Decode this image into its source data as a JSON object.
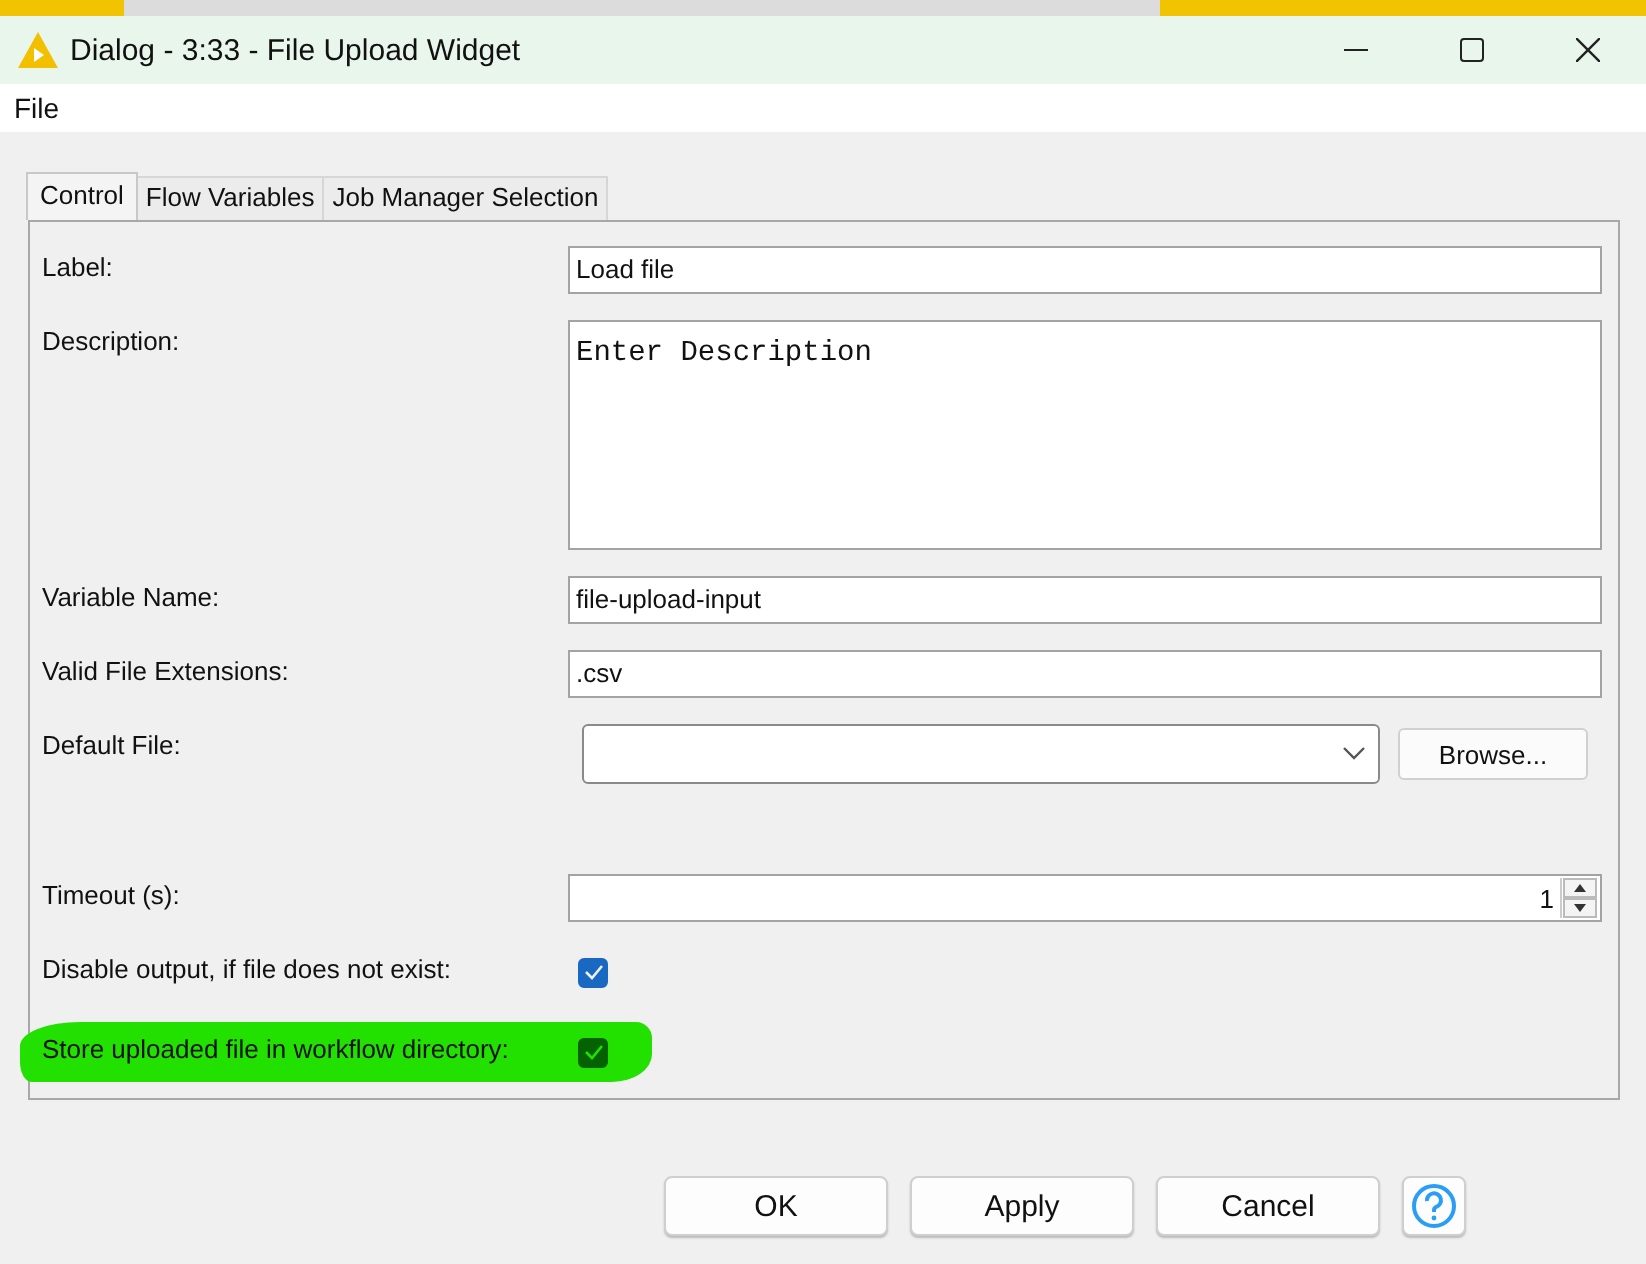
{
  "window": {
    "title": "Dialog - 3:33 - File Upload Widget"
  },
  "menu": [
    "File"
  ],
  "tabs": [
    {
      "label": "Control",
      "selected": true
    },
    {
      "label": "Flow Variables",
      "selected": false
    },
    {
      "label": "Job Manager Selection",
      "selected": false
    }
  ],
  "fields": [
    {
      "kind": "text",
      "label": "Label:",
      "value": "Load file"
    },
    {
      "kind": "textarea",
      "label": "Description:",
      "value": "Enter Description"
    },
    {
      "kind": "text",
      "label": "Variable Name:",
      "value": "file-upload-input"
    },
    {
      "kind": "text",
      "label": "Valid File Extensions:",
      "value": ".csv"
    },
    {
      "kind": "file",
      "label": "Default File:",
      "button": "Browse..."
    },
    {
      "kind": "spinner",
      "label": "Timeout (s):",
      "value": "1"
    },
    {
      "kind": "checkbox",
      "label": "Disable output, if file does not exist:",
      "checked": true,
      "highlighted": false
    },
    {
      "kind": "checkbox",
      "label": "Store uploaded file in workflow directory:",
      "checked": true,
      "highlighted": true
    }
  ],
  "buttons": [
    "OK",
    "Apply",
    "Cancel"
  ]
}
